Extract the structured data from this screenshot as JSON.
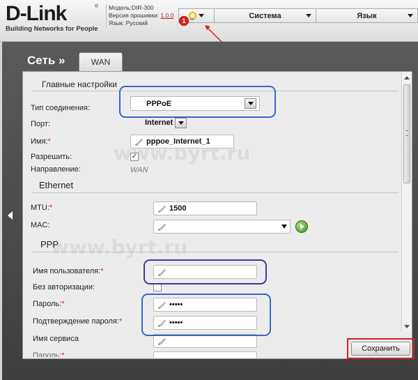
{
  "header": {
    "logo_text": "D-Link",
    "logo_reg": "®",
    "logo_tagline": "Building Networks for People",
    "model_label": "Модель:",
    "model_value": "DIR-300",
    "firmware_label": "Версия прошивки:",
    "firmware_value": "1.0.0",
    "language_label": "Язык:",
    "language_value": "Русский",
    "menu_system": "Система",
    "menu_language": "Язык",
    "badge_number": "1"
  },
  "nav": {
    "section_title": "Сеть »",
    "active_tab": "WAN"
  },
  "sections": {
    "main": "Главные настройки",
    "ethernet": "Ethernet",
    "ppp": "PPP"
  },
  "fields": {
    "connection_type_label": "Тип соединения:",
    "connection_type_value": "PPPoE",
    "port_label": "Порт:",
    "port_value": "Internet",
    "name_label": "Имя:",
    "name_value": "pppoe_Internet_1",
    "enable_label": "Разрешить:",
    "direction_label": "Направление:",
    "direction_value": "WAN",
    "mtu_label": "MTU:",
    "mtu_value": "1500",
    "mac_label": "MAC:",
    "mac_value": "",
    "username_label": "Имя пользователя:",
    "username_value": "",
    "no_auth_label": "Без авторизации:",
    "password_label": "Пароль:",
    "password_value": "•••••",
    "password_confirm_label": "Подтверждение пароля:",
    "password_confirm_value": "•••••",
    "service_name_label": "Имя сервиса",
    "service_name_value": "",
    "partial_label": "Пароль:"
  },
  "required_mark": "*",
  "checkmark": "✓",
  "buttons": {
    "save": "Сохранить"
  },
  "watermark": "www.byrt.ru",
  "colors": {
    "highlight_blue": "#3a63c9",
    "highlight_red": "#d42020",
    "badge_red": "#d42222",
    "frame_dark": "#4a4a4a"
  }
}
